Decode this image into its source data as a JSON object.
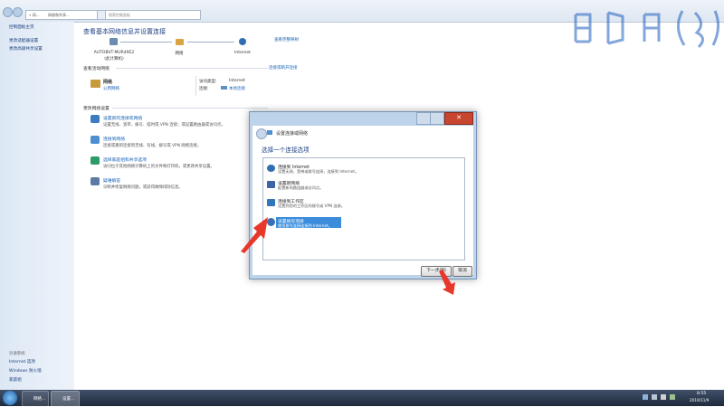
{
  "toolbar": {
    "address_prefix": "« 网...",
    "address_current": "网络和共享...",
    "search_placeholder": "搜索控制面板"
  },
  "sidebar": {
    "top_items": [
      {
        "label": "控制面板主页"
      },
      {
        "label": "更改适配器设置"
      },
      {
        "label": "更改高级共享设置"
      }
    ],
    "see_also_title": "另请参阅",
    "bottom_items": [
      {
        "label": "Internet 选项"
      },
      {
        "label": "Windows 防火墙"
      },
      {
        "label": "家庭组"
      }
    ]
  },
  "main": {
    "title": "查看基本网络信息并设置连接",
    "view_full_map": "查看完整映射",
    "map": {
      "computer_name": "AUTOBVT-MUR49E2",
      "computer_sub": "(此计算机)",
      "network": "网络",
      "internet": "Internet"
    },
    "active_title": "查看活动网络",
    "connect_disconnect": "连接或断开连接",
    "network_name": "网络",
    "network_type": "公用网络",
    "access_type_label": "访问类型:",
    "access_type_value": "Internet",
    "connection_label": "连接:",
    "connection_value": "本地连接",
    "change_title": "更改网络设置",
    "actions": [
      {
        "title": "设置新的连接或网络",
        "desc": "设置无线、宽带、拨号、临时或 VPN 连接；或设置路由器或访问点。"
      },
      {
        "title": "连接到网络",
        "desc": "连接或重新连接到无线、有线、拨号或 VPN 网络连接。"
      },
      {
        "title": "选择家庭组和共享选项",
        "desc": "访问位于其他网络计算机上的文件和打印机，或更改共享设置。"
      },
      {
        "title": "疑难解答",
        "desc": "诊断并修复网络问题，或获得故障排除信息。"
      }
    ]
  },
  "dialog": {
    "title": "设置连接或网络",
    "close_symbol": "✕",
    "heading": "选择一个连接选项",
    "options": [
      {
        "title": "连接到 Internet",
        "desc": "设置无线、宽带或拨号连接，连接到 Internet。"
      },
      {
        "title": "设置新网络",
        "desc": "配置新的路由器或访问点。"
      },
      {
        "title": "连接到工作区",
        "desc": "设置到您的工作区的拨号或 VPN 连接。"
      },
      {
        "title": "设置拨号连接",
        "desc": "使用拨号连接连接到 Internet。"
      }
    ],
    "next_button": "下一步(N)",
    "cancel_button": "取消"
  },
  "taskbar": {
    "app1": "网络...",
    "app2": "设置...",
    "time": "8:55",
    "date": "2019/11/9"
  },
  "colors": {
    "accent": "#1a64b5",
    "selection": "#3b8ddc",
    "arrow": "#e8382c"
  }
}
